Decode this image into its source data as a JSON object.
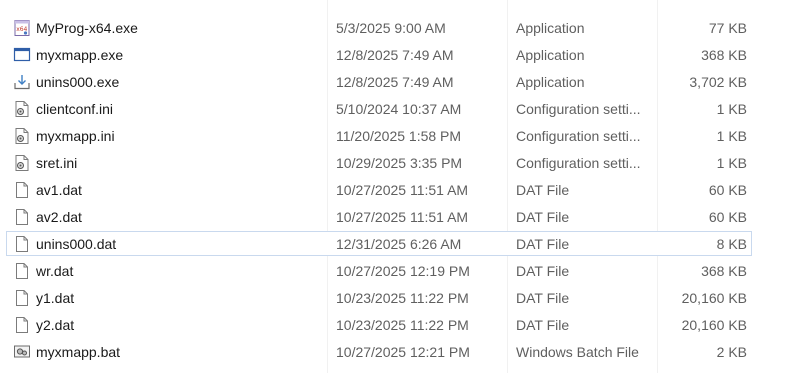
{
  "files": [
    {
      "name": "MyProg-x64.exe",
      "date": "5/3/2025 9:00 AM",
      "type": "Application",
      "size": "77 KB",
      "icon": "program-app-icon"
    },
    {
      "name": "myxmapp.exe",
      "date": "12/8/2025 7:49 AM",
      "type": "Application",
      "size": "368 KB",
      "icon": "window-app-icon"
    },
    {
      "name": "unins000.exe",
      "date": "12/8/2025 7:49 AM",
      "type": "Application",
      "size": "3,702 KB",
      "icon": "uninstall-app-icon"
    },
    {
      "name": "clientconf.ini",
      "date": "5/10/2024 10:37 AM",
      "type": "Configuration setti...",
      "size": "1 KB",
      "icon": "config-file-icon"
    },
    {
      "name": "myxmapp.ini",
      "date": "11/20/2025 1:58 PM",
      "type": "Configuration setti...",
      "size": "1 KB",
      "icon": "config-file-icon"
    },
    {
      "name": "sret.ini",
      "date": "10/29/2025 3:35 PM",
      "type": "Configuration setti...",
      "size": "1 KB",
      "icon": "config-file-icon"
    },
    {
      "name": "av1.dat",
      "date": "10/27/2025 11:51 AM",
      "type": "DAT File",
      "size": "60 KB",
      "icon": "blank-file-icon"
    },
    {
      "name": "av2.dat",
      "date": "10/27/2025 11:51 AM",
      "type": "DAT File",
      "size": "60 KB",
      "icon": "blank-file-icon"
    },
    {
      "name": "unins000.dat",
      "date": "12/31/2025 6:26 AM",
      "type": "DAT File",
      "size": "8 KB",
      "icon": "blank-file-icon"
    },
    {
      "name": "wr.dat",
      "date": "10/27/2025 12:19 PM",
      "type": "DAT File",
      "size": "368 KB",
      "icon": "blank-file-icon"
    },
    {
      "name": "y1.dat",
      "date": "10/23/2025 11:22 PM",
      "type": "DAT File",
      "size": "20,160 KB",
      "icon": "blank-file-icon"
    },
    {
      "name": "y2.dat",
      "date": "10/23/2025 11:22 PM",
      "type": "DAT File",
      "size": "20,160 KB",
      "icon": "blank-file-icon"
    },
    {
      "name": "myxmapp.bat",
      "date": "10/27/2025 12:21 PM",
      "type": "Windows Batch File",
      "size": "2 KB",
      "icon": "batch-file-icon"
    }
  ],
  "focused_index": 8,
  "colors": {
    "focus_border": "#c9d9ee",
    "secondary_text": "#5f5f5f",
    "primary_text": "#1a1a1a"
  }
}
